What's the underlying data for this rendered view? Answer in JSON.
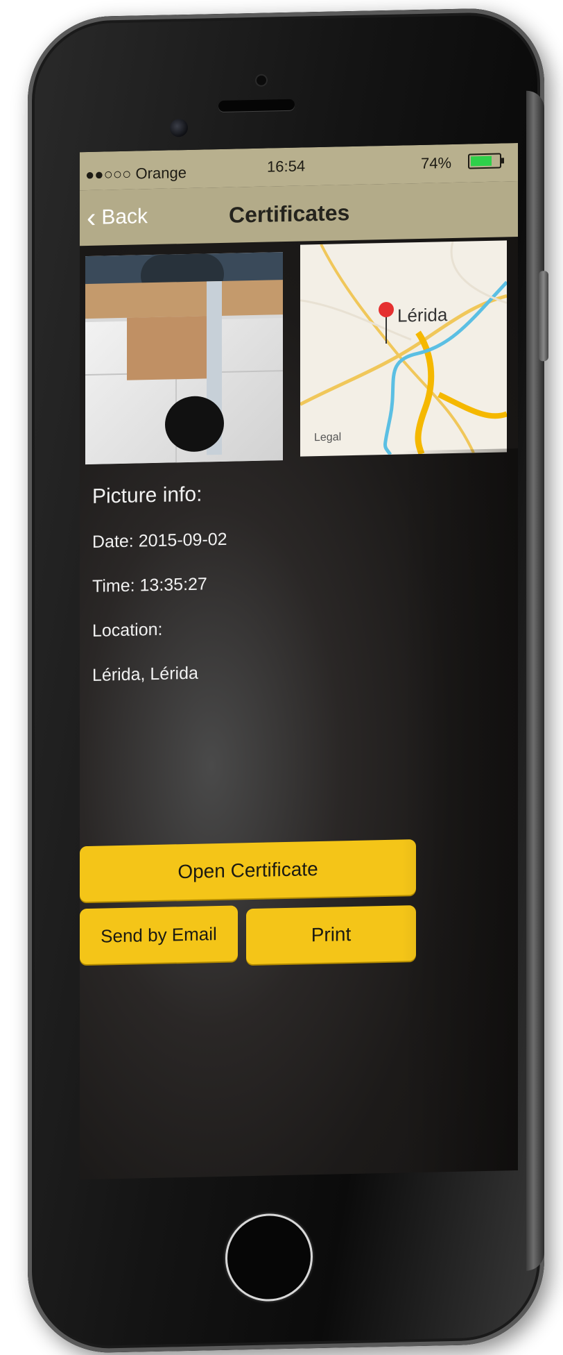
{
  "status_bar": {
    "carrier": "●●○○○ Orange",
    "wifi_icon": "wifi-icon",
    "time": "16:54",
    "battery_percent": "74%",
    "battery_level": 0.74
  },
  "nav": {
    "back_label": "Back",
    "back_icon": "chevron-left-icon",
    "title": "Certificates"
  },
  "map": {
    "city_label": "Lérida",
    "legal_label": "Legal"
  },
  "info": {
    "heading": "Picture info:",
    "date": "Date: 2015-09-02",
    "time": "Time: 13:35:27",
    "location": "Location:",
    "place": "Lérida, Lérida"
  },
  "buttons": {
    "open_certificate": "Open Certificate",
    "send_by_email": "Send by Email",
    "print": "Print"
  },
  "colors": {
    "accent": "#f4c518",
    "nav_background": "#b3ab89",
    "battery_fill": "#2fd04a"
  }
}
